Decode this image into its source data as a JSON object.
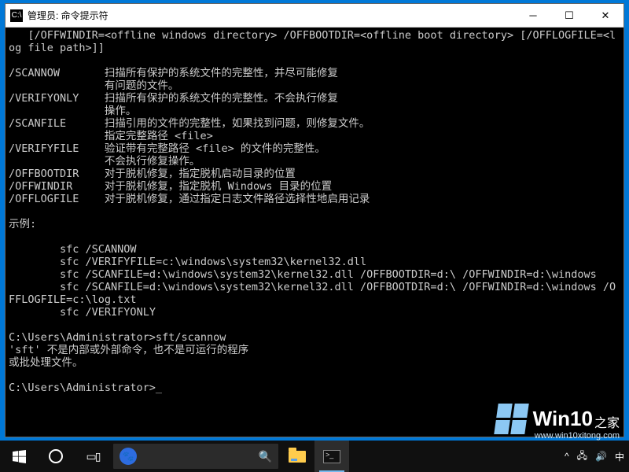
{
  "window": {
    "title": "管理员: 命令提示符",
    "icon_label": "C:\\"
  },
  "terminal": {
    "syntax_line": "   [/OFFWINDIR=<offline windows directory> /OFFBOOTDIR=<offline boot directory> [/OFFLOGFILE=<log file path>]]",
    "options": [
      {
        "flag": "/SCANNOW",
        "desc1": "扫描所有保护的系统文件的完整性，并尽可能修复",
        "desc2": "有问题的文件。"
      },
      {
        "flag": "/VERIFYONLY",
        "desc1": "扫描所有保护的系统文件的完整性。不会执行修复",
        "desc2": "操作。"
      },
      {
        "flag": "/SCANFILE",
        "desc1": "扫描引用的文件的完整性，如果找到问题，则修复文件。",
        "desc2": "指定完整路径 <file>"
      },
      {
        "flag": "/VERIFYFILE",
        "desc1": "验证带有完整路径 <file> 的文件的完整性。",
        "desc2": "不会执行修复操作。"
      },
      {
        "flag": "/OFFBOOTDIR",
        "desc1": "对于脱机修复，指定脱机启动目录的位置",
        "desc2": ""
      },
      {
        "flag": "/OFFWINDIR",
        "desc1": "对于脱机修复，指定脱机 Windows 目录的位置",
        "desc2": ""
      },
      {
        "flag": "/OFFLOGFILE",
        "desc1": "对于脱机修复，通过指定日志文件路径选择性地启用记录",
        "desc2": ""
      }
    ],
    "examples_header": "示例:",
    "examples": [
      "sfc /SCANNOW",
      "sfc /VERIFYFILE=c:\\windows\\system32\\kernel32.dll",
      "sfc /SCANFILE=d:\\windows\\system32\\kernel32.dll /OFFBOOTDIR=d:\\ /OFFWINDIR=d:\\windows",
      "sfc /SCANFILE=d:\\windows\\system32\\kernel32.dll /OFFBOOTDIR=d:\\ /OFFWINDIR=d:\\windows /OFFLOGFILE=c:\\log.txt",
      "sfc /VERIFYONLY"
    ],
    "prompt1": "C:\\Users\\Administrator>",
    "cmd1": "sft/scannow",
    "error1": "'sft' 不是内部或外部命令，也不是可运行的程序",
    "error2": "或批处理文件。",
    "prompt2": "C:\\Users\\Administrator>"
  },
  "taskbar": {
    "search_placeholder": " ",
    "tray_chevron": "^",
    "tray_net": "🖧",
    "tray_vol": "🔊",
    "tray_ime": "中"
  },
  "watermark": {
    "brand1": "Win10",
    "brand2": "之家",
    "url": "www.win10xitong.com"
  }
}
